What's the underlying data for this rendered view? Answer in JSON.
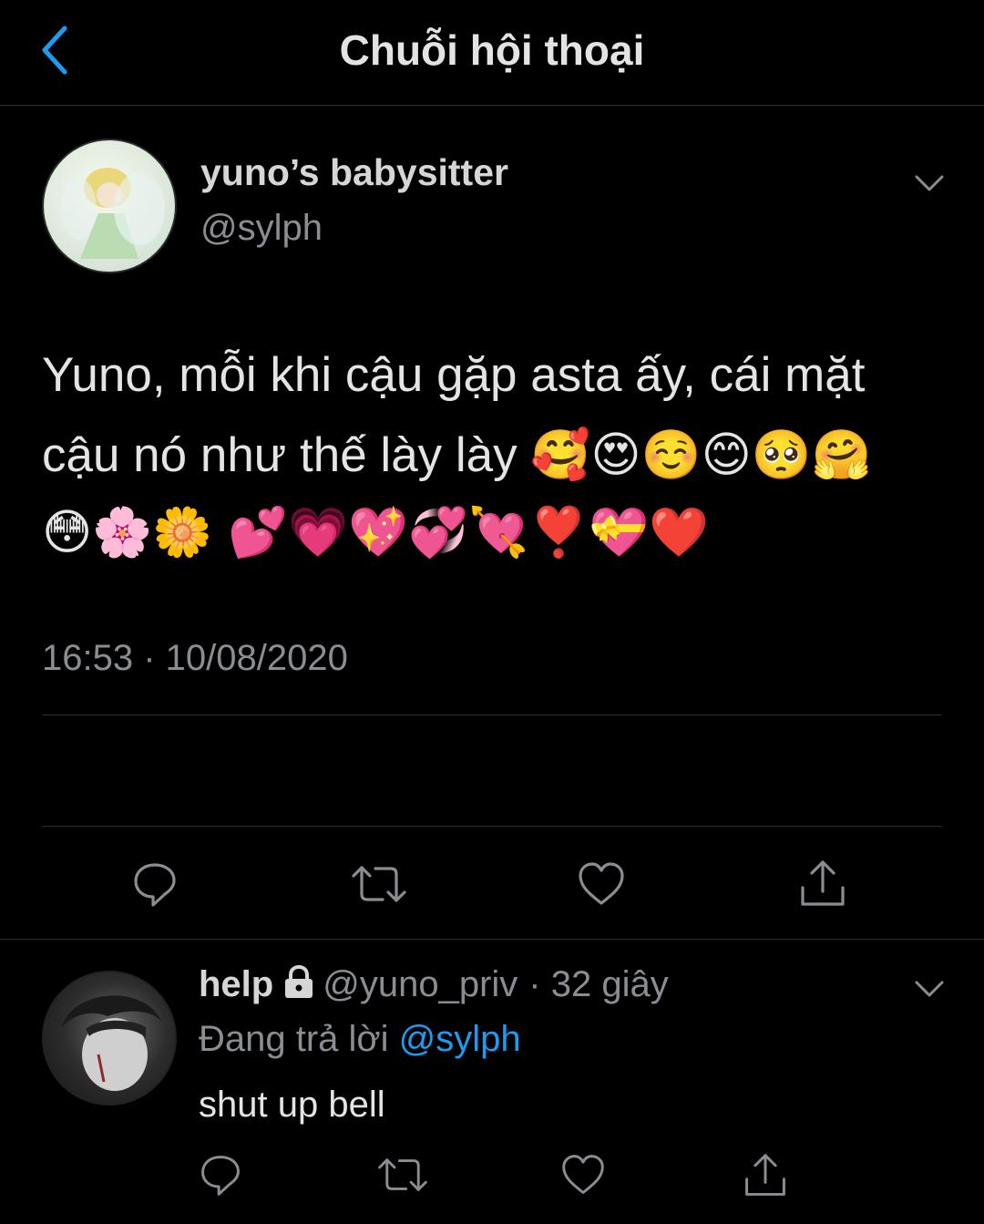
{
  "header": {
    "title": "Chuỗi hội thoại",
    "back_icon": "chevron-left-icon",
    "accent": "#1d9bf0"
  },
  "tweet": {
    "display_name": "yuno’s babysitter",
    "handle": "@sylph",
    "text": "Yuno, mỗi khi cậu gặp asta ấy, cái mặt cậu nó như thế lày lày 🥰😍☺️😊🥺🤗",
    "emoji_line": "😳🌸🌼 💕💗💖💞💘❣️💝❤️",
    "timestamp": "16:53 · 10/08/2020",
    "actions": [
      "reply-icon",
      "retweet-icon",
      "like-icon",
      "share-icon"
    ]
  },
  "reply": {
    "display_name": "help",
    "handle": "@yuno_priv",
    "time": "· 32 giây",
    "replying_prefix": "Đang trả lời",
    "replying_to": "@sylph",
    "text": "shut up bell",
    "actions": [
      "reply-icon",
      "retweet-icon",
      "like-icon",
      "share-icon"
    ]
  },
  "colors": {
    "background": "#000000",
    "text": "#e4e4e4",
    "secondary": "#8a8d91",
    "link": "#1d9bf0",
    "divider": "#2a2f35"
  }
}
